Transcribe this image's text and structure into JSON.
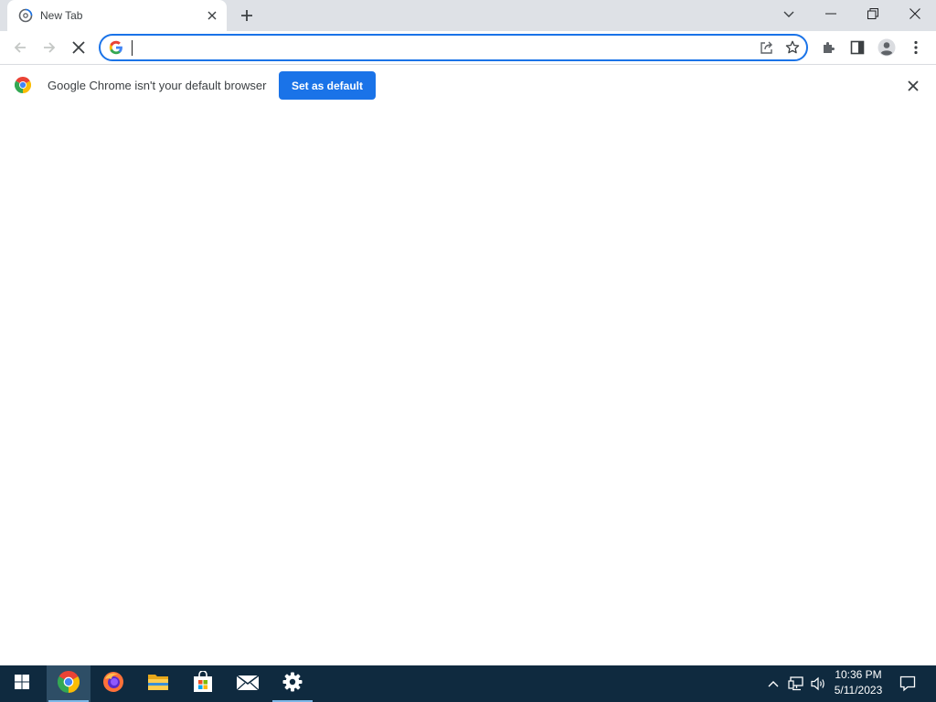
{
  "browser": {
    "tab": {
      "title": "New Tab"
    },
    "window_controls": [
      "tab-search",
      "minimize",
      "restore",
      "close"
    ]
  },
  "toolbar": {
    "omnibox": {
      "value": "",
      "placeholder": ""
    }
  },
  "infobar": {
    "message": "Google Chrome isn't your default browser",
    "button_label": "Set as default"
  },
  "taskbar": {
    "apps": [
      {
        "name": "start",
        "icon": "windows-logo-icon"
      },
      {
        "name": "chrome",
        "icon": "chrome-icon",
        "active": true
      },
      {
        "name": "firefox",
        "icon": "firefox-icon"
      },
      {
        "name": "file-explorer",
        "icon": "folder-icon"
      },
      {
        "name": "microsoft-store",
        "icon": "store-icon"
      },
      {
        "name": "mail",
        "icon": "mail-icon"
      },
      {
        "name": "settings",
        "icon": "gear-icon",
        "running": true
      }
    ],
    "clock": {
      "time": "10:36 PM",
      "date": "5/11/2023"
    }
  },
  "colors": {
    "tabstrip": "#dee1e6",
    "accent": "#1a73e8",
    "taskbar": "#0f2a3f"
  }
}
